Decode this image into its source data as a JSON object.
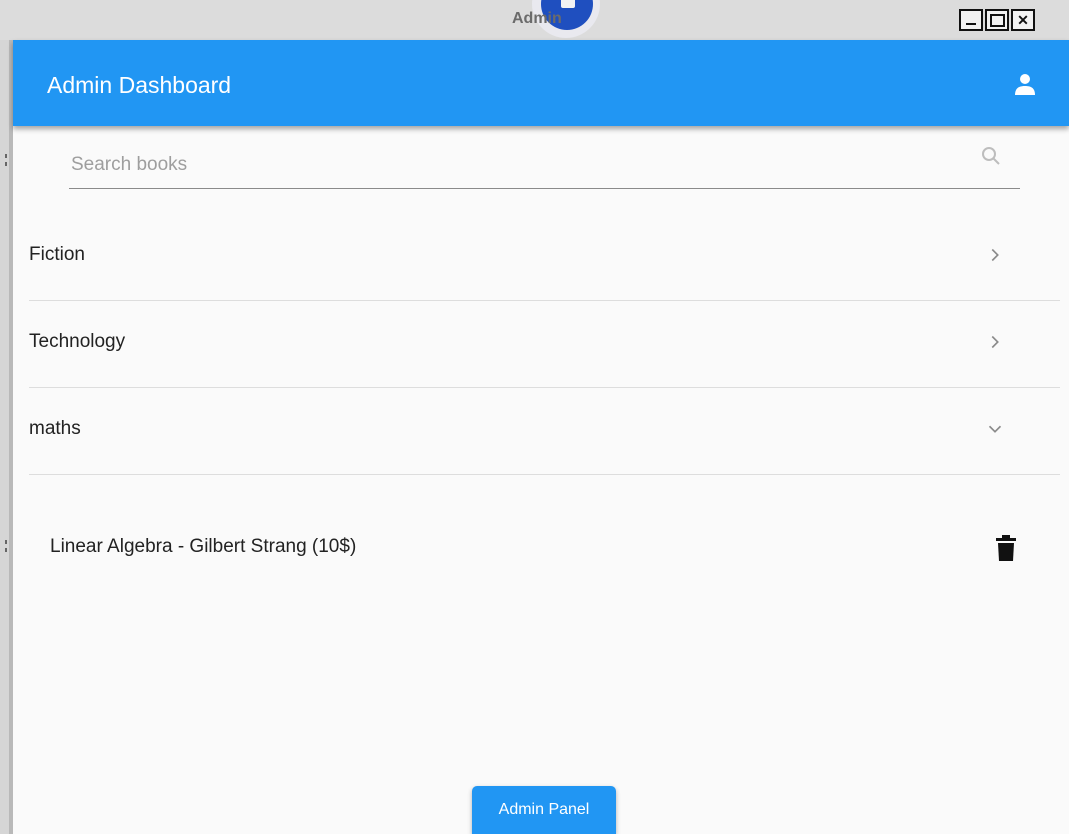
{
  "window": {
    "title": "Admin",
    "close_glyph": "✕"
  },
  "appbar": {
    "title": "Admin Dashboard",
    "account_icon": "person-icon"
  },
  "search": {
    "placeholder": "Search books",
    "value": "",
    "icon": "search-icon"
  },
  "categories": [
    {
      "label": "Fiction",
      "expanded": false
    },
    {
      "label": "Technology",
      "expanded": false
    },
    {
      "label": "maths",
      "expanded": true
    }
  ],
  "books": [
    {
      "label": "Linear Algebra - Gilbert Strang (10$)",
      "action_icon": "trash-icon"
    }
  ],
  "fab": {
    "label": "Admin Panel"
  },
  "colors": {
    "primary": "#2196f3",
    "surface": "#fafafa"
  }
}
